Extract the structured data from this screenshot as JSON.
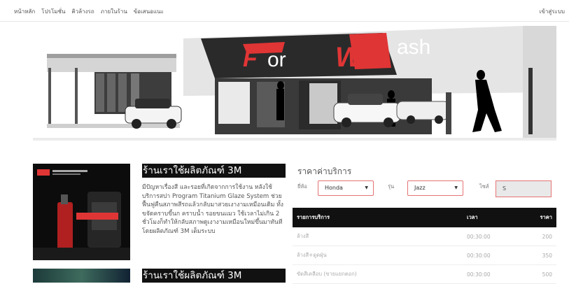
{
  "nav": {
    "items": [
      "หน้าหลัก",
      "โปรโมชั่น",
      "คิวล้างรถ",
      "ภายในร้าน",
      "ข้อเสนอแนะ"
    ],
    "login": "เข้าสู่ระบบ"
  },
  "hero": {
    "logo_parts": [
      "F",
      "or",
      "W",
      "ash"
    ]
  },
  "promo": {
    "title": "ร้านเราใช้ผลิตภัณฑ์ 3M",
    "text": "มีปัญหาเรื่องสี และรอยที่เกิดจากการใช้งาน หลังใช้บริการสปา Program Titanium Glaze System ช่วยฟื้นฟูคืนสภาพสีรถแล้วกลับมาสวยเงางามเหมือนเดิม ทั้งขจัดคราบขี้นก คราบน้ำ รอยขนแมว ใช้เวลาไม่เกิน 2 ชั่วโมงก็ทำให้กลับสภาพดูเงางามเหมือนใหม่ขึ้นมาทันทีโดยผลิตภัณฑ์ 3M เต็มระบบ",
    "title2": "ร้านเราใช้ผลิตภัณฑ์ 3M"
  },
  "pricing": {
    "heading": "ราคาค่าบริการ",
    "brand_label": "ยี่ห้อ",
    "brand_value": "Honda",
    "model_label": "รุ่น",
    "model_value": "Jazz",
    "size_label": "ไซส์",
    "size_value": "S",
    "columns": [
      "รายการบริการ",
      "เวลา",
      "ราคา"
    ],
    "rows": [
      {
        "service": "ล้างสี",
        "time": "00:30:00",
        "price": "200"
      },
      {
        "service": "ล้างสี+ดูดฝุ่น",
        "time": "00:30:00",
        "price": "350"
      },
      {
        "service": "ขัดสีเคลือบ (ขายแยกตอก)",
        "time": "00:30:00",
        "price": "500"
      }
    ]
  },
  "colors": {
    "accent_red": "#e03535",
    "dark": "#111111",
    "input_border": "#e57373"
  }
}
